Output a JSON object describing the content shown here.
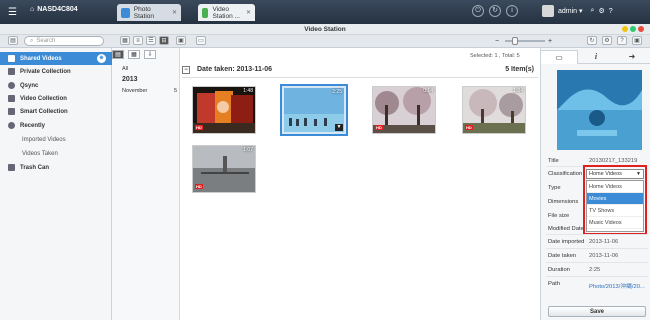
{
  "topbar": {
    "nas_name": "NASD4C804",
    "tabs": [
      {
        "label": "Photo Station",
        "close": "✕"
      },
      {
        "label": "Video Station ...",
        "close": "✕"
      }
    ],
    "user": "admin ▾"
  },
  "window_title": "Video Station",
  "toolbar": {
    "search_placeholder": "Search",
    "selected_label": "Selected: 1 , Total: 5"
  },
  "sidebar": {
    "items": [
      {
        "label": "Shared Videos",
        "badge": "⊕"
      },
      {
        "label": "Private Collection"
      },
      {
        "label": "Qsync"
      },
      {
        "label": "Video Collection"
      },
      {
        "label": "Smart Collection"
      },
      {
        "label": "Recently"
      },
      {
        "label": "Imported Videos"
      },
      {
        "label": "Videos Taken"
      },
      {
        "label": "Trash Can"
      }
    ]
  },
  "tree": {
    "all": "All",
    "year": "2013",
    "month": "November",
    "month_count": "5"
  },
  "main": {
    "date_header": "Date taken: 2013-11-06",
    "item_count": "5 Item(s)",
    "thumbs": [
      {
        "duration": "1:48",
        "badge": "HD"
      },
      {
        "duration": "2:25",
        "badge": "▼"
      },
      {
        "duration": "0:14",
        "badge": "HD"
      },
      {
        "duration": "1:04",
        "badge": "HD"
      },
      {
        "duration": "1:07",
        "badge": "HD"
      }
    ]
  },
  "details": {
    "title_label": "Title",
    "title_value": "20130217_133219",
    "classification_label": "Classification",
    "classification_value": "Home Videos",
    "type_label": "Type",
    "dimensions_label": "Dimensions",
    "file_size_label": "File size",
    "modified_label": "Modified Date",
    "date_imported_label": "Date imported",
    "date_imported_value": "2013-11-06",
    "date_taken_label": "Date taken",
    "date_taken_value": "2013-11-06",
    "duration_label": "Duration",
    "duration_value": "2:25",
    "path_label": "Path",
    "path_value": "Photo/2013/沖縄/20...",
    "options": [
      "Home Videos",
      "Movies",
      "TV Shows",
      "Music Videos"
    ],
    "save_label": "Save"
  },
  "colors": {
    "accent": "#3b8bd6",
    "highlight_box": "#e02020"
  }
}
